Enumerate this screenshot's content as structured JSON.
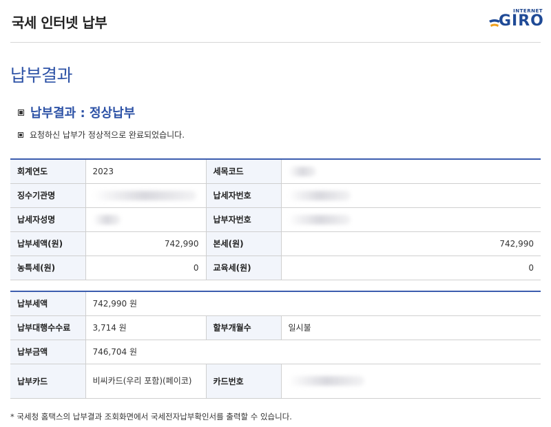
{
  "header": {
    "title": "국세 인터넷 납부",
    "logo_small": "INTERNET",
    "logo_big": "GIRO"
  },
  "page_title": "납부결과",
  "result": {
    "text": "납부결과 : 정상납부"
  },
  "message": "요청하신 납부가 정상적으로 완료되었습니다.",
  "table1": {
    "fiscal_year_label": "회계연도",
    "fiscal_year": "2023",
    "tax_code_label": "세목코드",
    "collector_label": "징수기관명",
    "taxpayer_no_label": "납세자번호",
    "taxpayer_name_label": "납세자성명",
    "payer_no_label": "납부자번호",
    "tax_amount_label": "납부세액(원)",
    "tax_amount": "742,990",
    "principal_label": "본세(원)",
    "principal": "742,990",
    "rural_tax_label": "농특세(원)",
    "rural_tax": "0",
    "edu_tax_label": "교육세(원)",
    "edu_tax": "0"
  },
  "table2": {
    "tax_amount_label": "납부세액",
    "tax_amount": "742,990 원",
    "fee_label": "납부대행수수료",
    "fee": "3,714 원",
    "installment_label": "할부개월수",
    "installment": "일시불",
    "total_label": "납부금액",
    "total": "746,704 원",
    "card_label": "납부카드",
    "card": "비씨카드(우리 포함)(페이코)",
    "card_no_label": "카드번호"
  },
  "footnote": "* 국세청 홈택스의 납부결과 조회화면에서 국세전자납부확인서를 출력할 수 있습니다.",
  "colors": {
    "accent": "#2d52a6",
    "label_bg": "#f2f5fb",
    "border_top": "#3b5cae"
  }
}
